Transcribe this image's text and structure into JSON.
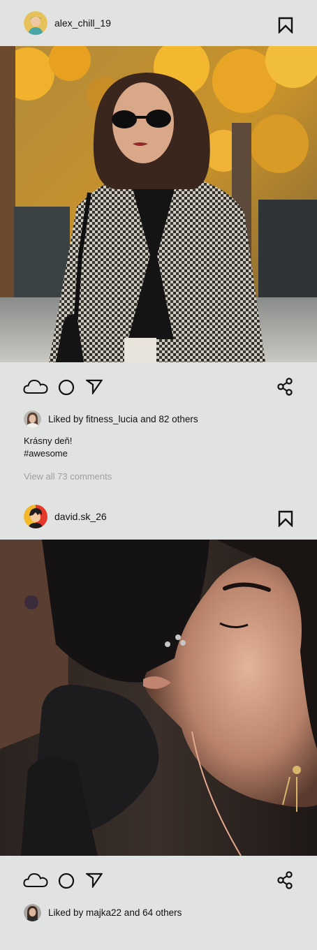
{
  "posts": [
    {
      "username": "alex_chill_19",
      "liked_by_text": "Liked by fitness_lucia and 82 others",
      "caption_line1": "Krásny deň!",
      "caption_line2": "#awesome",
      "view_comments": "View all 73 comments"
    },
    {
      "username": "david.sk_26",
      "liked_by_text": "Liked by majka22 and 64 others"
    }
  ],
  "icons": {
    "like": "cloud-icon",
    "comment": "circle-icon",
    "send": "send-arrow-icon",
    "share": "share-icon",
    "save": "bookmark-icon"
  },
  "colors": {
    "background": "#e1e3e2",
    "text": "#111111",
    "muted_text": "#9ea0a0"
  }
}
